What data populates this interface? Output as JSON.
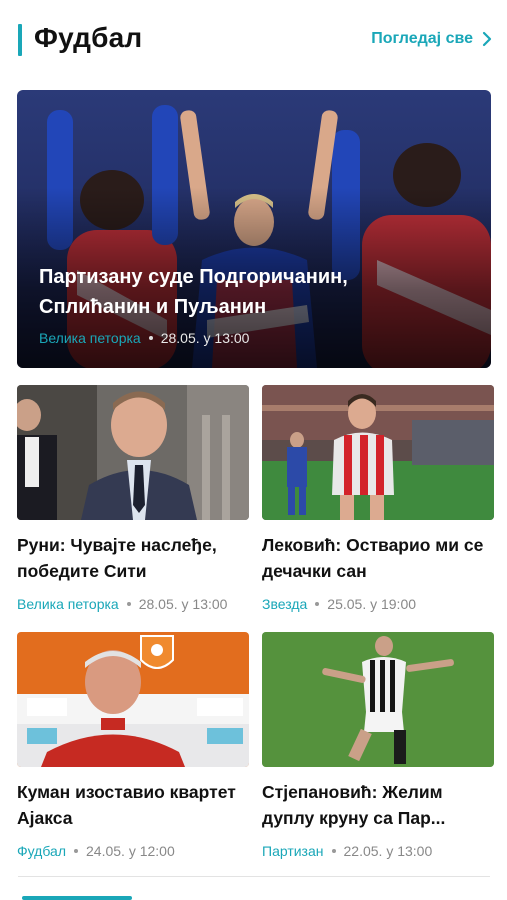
{
  "section": {
    "title": "Фудбал",
    "see_all_label": "Погледај све",
    "accent": "#1aa7b8"
  },
  "hero": {
    "title": "Партизану суде Подгоричанин, Сплићанин и Пуљанин",
    "tag": "Велика петорка",
    "datetime": "28.05. у 13:00"
  },
  "cards": [
    {
      "title": "Руни: Чувајте наслеђе, победите Сити",
      "tag": "Велика петорка",
      "datetime": "28.05. у 13:00"
    },
    {
      "title": "Лековић: Остварио ми се дечачки сан",
      "tag": "Звезда",
      "datetime": "25.05. у 19:00"
    },
    {
      "title": "Куман изоставио квартет Ајакса",
      "tag": "Фудбал",
      "datetime": "24.05. у 12:00"
    },
    {
      "title": "Стјепановић: Желим дуплу круну са Пар...",
      "tag": "Партизан",
      "datetime": "22.05. у 13:00"
    }
  ],
  "icons": {
    "see_all": "chevron-right-icon"
  }
}
